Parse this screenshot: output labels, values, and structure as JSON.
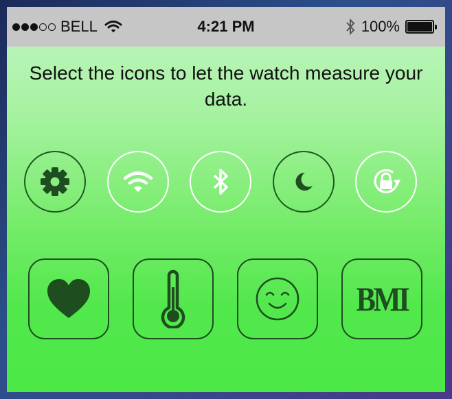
{
  "status_bar": {
    "carrier": "BELL",
    "time": "4:21 PM",
    "battery": "100%",
    "signal_strength": 3,
    "signal_total": 5
  },
  "instruction": "Select the icons to let the watch measure your data.",
  "toggles": [
    {
      "icon": "gear-icon",
      "style": "dark"
    },
    {
      "icon": "wifi-icon",
      "style": "light"
    },
    {
      "icon": "bluetooth-icon",
      "style": "light"
    },
    {
      "icon": "moon-icon",
      "style": "dark"
    },
    {
      "icon": "rotation-lock-icon",
      "style": "light"
    }
  ],
  "metrics": [
    {
      "icon": "heart-icon"
    },
    {
      "icon": "thermometer-icon"
    },
    {
      "icon": "smiley-icon"
    },
    {
      "icon": "bmi-icon",
      "label": "BMI"
    }
  ],
  "colors": {
    "dark_green": "#1e4d20",
    "ring_dark": "#1d5a21",
    "ring_light": "#ffffff",
    "status_bar_bg": "#c6c6c6"
  }
}
